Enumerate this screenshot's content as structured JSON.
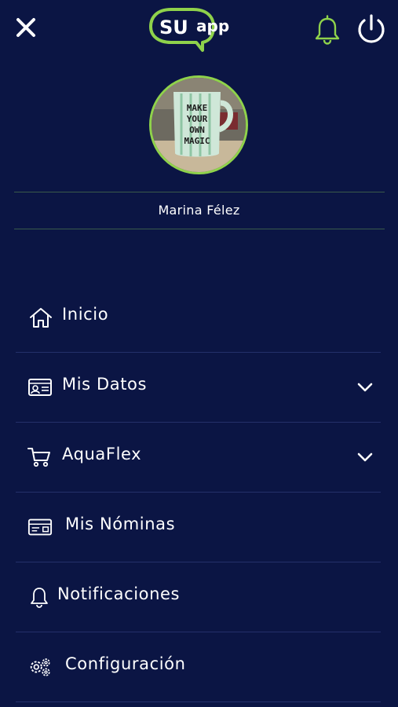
{
  "app": {
    "logo_text_main": "SU",
    "logo_text_sub": "app"
  },
  "header": {
    "close_icon": "close-icon",
    "bell_icon": "bell-icon",
    "power_icon": "power-icon",
    "accent_color": "#8fd24b"
  },
  "profile": {
    "name": "Marina Félez",
    "avatar_text": [
      "MAKE",
      "YOUR",
      "OWN",
      "MAGIC"
    ]
  },
  "menu": {
    "items": [
      {
        "label": "Inicio",
        "icon": "home-icon",
        "has_submenu": false
      },
      {
        "label": "Mis Datos",
        "icon": "id-card-icon",
        "has_submenu": true
      },
      {
        "label": "AquaFlex",
        "icon": "cart-icon",
        "has_submenu": true
      },
      {
        "label": "Mis Nóminas",
        "icon": "payslip-icon",
        "has_submenu": false
      },
      {
        "label": "Notificaciones",
        "icon": "bell-icon",
        "has_submenu": false
      },
      {
        "label": "Configuración",
        "icon": "gears-icon",
        "has_submenu": false
      }
    ]
  },
  "colors": {
    "background": "#0b1544",
    "accent": "#8fd24b",
    "text": "#ffffff"
  }
}
